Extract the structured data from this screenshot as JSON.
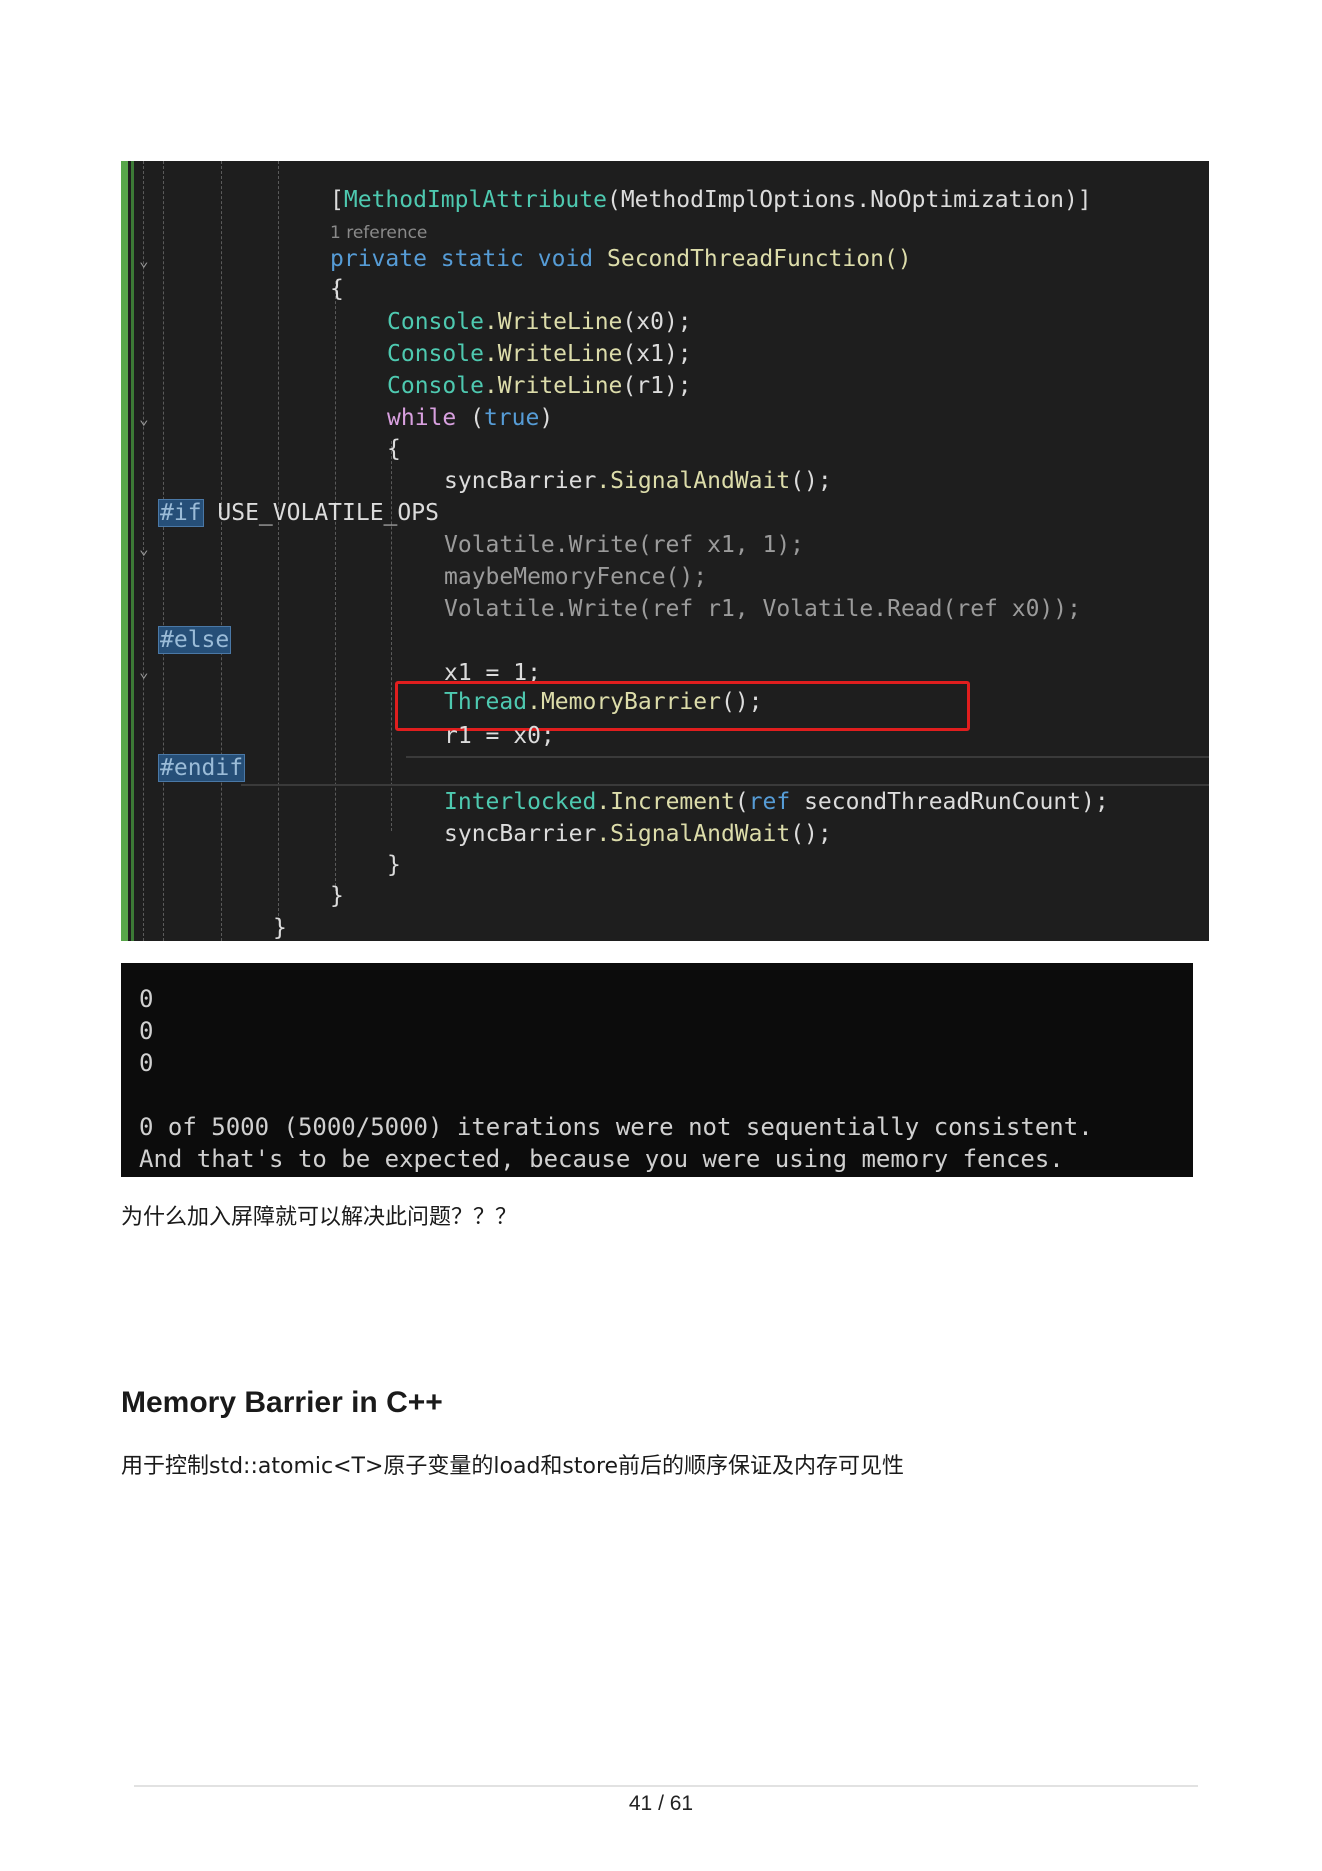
{
  "code": {
    "attribute_line": {
      "open": "[",
      "attr": "MethodImplAttribute",
      "paren_open": "(",
      "enum_type": "MethodImplOptions",
      "enum_value": ".NoOptimization",
      "close": ")]"
    },
    "references": "1 reference",
    "signature": {
      "mod1": "private",
      "mod2": "static",
      "ret": "void",
      "name": "SecondThreadFunction()"
    },
    "lines": {
      "brace_open": "{",
      "wl0_type": "Console",
      "wl0_fn": ".WriteLine",
      "wl0_rest": "(x0);",
      "wl1_type": "Console",
      "wl1_fn": ".WriteLine",
      "wl1_rest": "(x1);",
      "wl2_type": "Console",
      "wl2_fn": ".WriteLine",
      "wl2_rest": "(r1);",
      "while_kw": "while",
      "while_open": " (",
      "while_true": "true",
      "while_close": ")",
      "while_brace": "{",
      "sync1": "syncBarrier",
      "sync1_fn": ".SignalAndWait",
      "sync1_rest": "();",
      "if_directive": "#if",
      "if_symbol": " USE_VOLATILE_OPS",
      "vol1": "Volatile.Write(ref x1, 1);",
      "maybe": "maybeMemoryFence();",
      "vol2": "Volatile.Write(ref r1, Volatile.Read(ref x0));",
      "else_directive": "#else",
      "x1_assign": "x1 = 1;",
      "thread_type": "Thread",
      "thread_fn": ".MemoryBarrier",
      "thread_rest": "();",
      "r1_assign": "r1 = x0;",
      "endif_directive": "#endif",
      "inter_type": "Interlocked",
      "inter_fn": ".Increment",
      "inter_open": "(",
      "inter_ref": "ref",
      "inter_rest": " secondThreadRunCount);",
      "sync2": "syncBarrier",
      "sync2_fn": ".SignalAndWait",
      "sync2_rest": "();",
      "close1": "}",
      "close2": "}",
      "close3": "}"
    }
  },
  "console": {
    "lines": [
      "0",
      "0",
      "0",
      "",
      "0 of 5000 (5000/5000) iterations were not sequentially consistent.",
      "And that's to be expected, because you were using memory fences."
    ]
  },
  "text": {
    "question": "为什么加入屏障就可以解决此问题？？？",
    "heading": "Memory Barrier in C++",
    "description": "用于控制std::atomic<T>原子变量的load和store前后的顺序保证及内存可见性"
  },
  "footer": {
    "page": "41 / 61"
  },
  "colors": {
    "highlight_box": "#e01e1e",
    "editor_bg": "#1e1e1e",
    "console_bg": "#0c0c0c"
  }
}
